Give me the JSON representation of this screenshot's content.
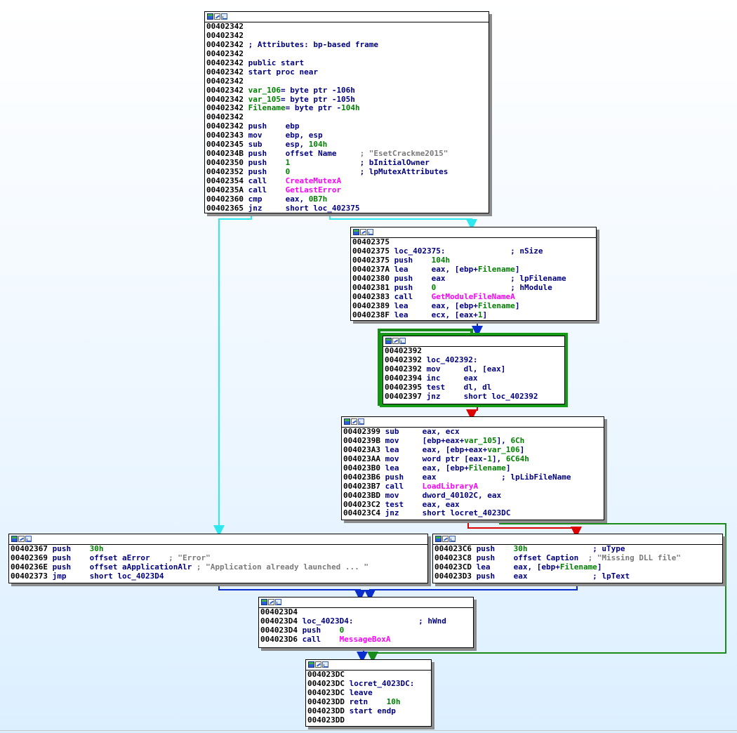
{
  "colors": {
    "edge_unconditional": "#0a2ecc",
    "edge_true": "#1a8a1a",
    "edge_false": "#dd0000",
    "edge_fallthrough_cyan": "#2ee8f0",
    "selected_outline": "#159a15",
    "address": "#000000",
    "mnemonic": "#000080",
    "immediate": "#008000",
    "comment": "#7a7a7a",
    "import": "#ff00ff"
  },
  "icons": [
    "graph-overview-icon",
    "edit-node-icon",
    "node-image-icon"
  ],
  "nodes": {
    "n1": {
      "lines": [
        {
          "a": "00402342",
          "t": ""
        },
        {
          "a": "00402342",
          "t": ""
        },
        {
          "a": "00402342",
          "t": " ; Attributes: bp-based frame"
        },
        {
          "a": "00402342",
          "t": ""
        },
        {
          "a": "00402342",
          "t": " public start"
        },
        {
          "a": "00402342",
          "t": " start proc near"
        },
        {
          "a": "00402342",
          "t": ""
        },
        {
          "a": "00402342",
          "t": " var_106= byte ptr -106h"
        },
        {
          "a": "00402342",
          "t": " var_105= byte ptr -105h"
        },
        {
          "a": "00402342",
          "t": " Filename= byte ptr -104h"
        },
        {
          "a": "00402342",
          "t": ""
        },
        {
          "a": "00402342",
          "t": " push    ebp"
        },
        {
          "a": "00402343",
          "t": " mov     ebp, esp"
        },
        {
          "a": "00402345",
          "t": " sub     esp, 104h"
        },
        {
          "a": "0040234B",
          "t": " push    offset Name     ; \"EsetCrackme2015\""
        },
        {
          "a": "00402350",
          "t": " push    1               ; bInitialOwner"
        },
        {
          "a": "00402352",
          "t": " push    0               ; lpMutexAttributes"
        },
        {
          "a": "00402354",
          "t": " call    CreateMutexA"
        },
        {
          "a": "0040235A",
          "t": " call    GetLastError"
        },
        {
          "a": "00402360",
          "t": " cmp     eax, 0B7h"
        },
        {
          "a": "00402365",
          "t": " jnz     short loc_402375"
        }
      ]
    },
    "n2": {
      "lines": [
        {
          "a": "00402375",
          "t": ""
        },
        {
          "a": "00402375",
          "t": " loc_402375:              ; nSize"
        },
        {
          "a": "00402375",
          "t": " push    104h"
        },
        {
          "a": "0040237A",
          "t": " lea     eax, [ebp+Filename]"
        },
        {
          "a": "00402380",
          "t": " push    eax              ; lpFilename"
        },
        {
          "a": "00402381",
          "t": " push    0                ; hModule"
        },
        {
          "a": "00402383",
          "t": " call    GetModuleFileNameA"
        },
        {
          "a": "00402389",
          "t": " lea     eax, [ebp+Filename]"
        },
        {
          "a": "0040238F",
          "t": " lea     ecx, [eax+1]"
        }
      ]
    },
    "n3": {
      "lines": [
        {
          "a": "00402392",
          "t": ""
        },
        {
          "a": "00402392",
          "t": " loc_402392:"
        },
        {
          "a": "00402392",
          "t": " mov     dl, [eax]"
        },
        {
          "a": "00402394",
          "t": " inc     eax"
        },
        {
          "a": "00402395",
          "t": " test    dl, dl"
        },
        {
          "a": "00402397",
          "t": " jnz     short loc_402392"
        }
      ]
    },
    "n4": {
      "lines": [
        {
          "a": "00402399",
          "t": " sub     eax, ecx"
        },
        {
          "a": "0040239B",
          "t": " mov     [ebp+eax+var_105], 6Ch"
        },
        {
          "a": "004023A3",
          "t": " lea     eax, [ebp+eax+var_106]"
        },
        {
          "a": "004023AA",
          "t": " mov     word ptr [eax-1], 6C64h"
        },
        {
          "a": "004023B0",
          "t": " lea     eax, [ebp+Filename]"
        },
        {
          "a": "004023B6",
          "t": " push    eax              ; lpLibFileName"
        },
        {
          "a": "004023B7",
          "t": " call    LoadLibraryA"
        },
        {
          "a": "004023BD",
          "t": " mov     dword_40102C, eax"
        },
        {
          "a": "004023C2",
          "t": " test    eax, eax"
        },
        {
          "a": "004023C4",
          "t": " jnz     short locret_4023DC"
        }
      ]
    },
    "n5": {
      "lines": [
        {
          "a": "00402367",
          "t": " push    30h"
        },
        {
          "a": "00402369",
          "t": " push    offset aError    ; \"Error\""
        },
        {
          "a": "0040236E",
          "t": " push    offset aApplicationAlr ; \"Application already launched ... \""
        },
        {
          "a": "00402373",
          "t": " jmp     short loc_4023D4"
        }
      ]
    },
    "n6": {
      "lines": [
        {
          "a": "004023C6",
          "t": " push    30h              ; uType"
        },
        {
          "a": "004023C8",
          "t": " push    offset Caption  ; \"Missing DLL file\""
        },
        {
          "a": "004023CD",
          "t": " lea     eax, [ebp+Filename]"
        },
        {
          "a": "004023D3",
          "t": " push    eax              ; lpText"
        }
      ]
    },
    "n7": {
      "lines": [
        {
          "a": "004023D4",
          "t": ""
        },
        {
          "a": "004023D4",
          "t": " loc_4023D4:              ; hWnd"
        },
        {
          "a": "004023D4",
          "t": " push    0"
        },
        {
          "a": "004023D6",
          "t": " call    MessageBoxA"
        }
      ]
    },
    "n8": {
      "lines": [
        {
          "a": "004023DC",
          "t": ""
        },
        {
          "a": "004023DC",
          "t": " locret_4023DC:"
        },
        {
          "a": "004023DC",
          "t": " leave"
        },
        {
          "a": "004023DD",
          "t": " retn    10h"
        },
        {
          "a": "004023DD",
          "t": " start endp"
        },
        {
          "a": "004023DD",
          "t": ""
        }
      ]
    }
  }
}
